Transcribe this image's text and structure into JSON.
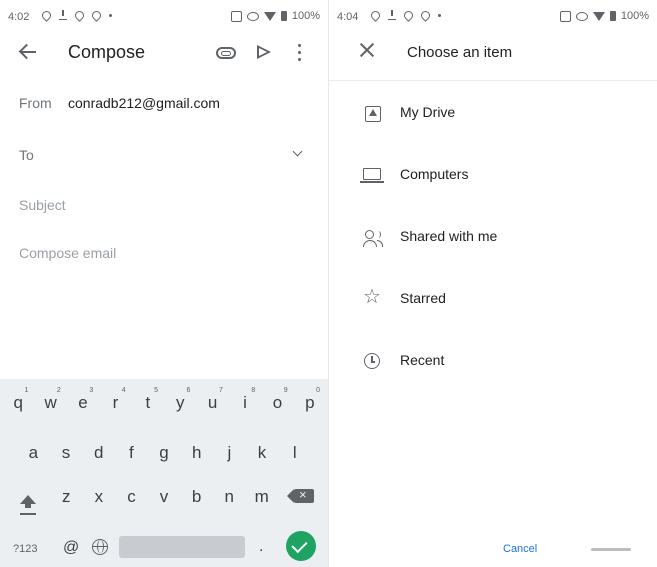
{
  "left_screen": {
    "status": {
      "time": "4:02",
      "battery": "100%"
    },
    "app_bar": {
      "title": "Compose"
    },
    "from": {
      "label": "From",
      "value": "conradb212@gmail.com"
    },
    "to": {
      "label": "To"
    },
    "subject": {
      "placeholder": "Subject"
    },
    "body": {
      "placeholder": "Compose email"
    },
    "keyboard": {
      "row1": [
        {
          "key": "q",
          "hint": "1"
        },
        {
          "key": "w",
          "hint": "2"
        },
        {
          "key": "e",
          "hint": "3"
        },
        {
          "key": "r",
          "hint": "4"
        },
        {
          "key": "t",
          "hint": "5"
        },
        {
          "key": "y",
          "hint": "6"
        },
        {
          "key": "u",
          "hint": "7"
        },
        {
          "key": "i",
          "hint": "8"
        },
        {
          "key": "o",
          "hint": "9"
        },
        {
          "key": "p",
          "hint": "0"
        }
      ],
      "row2": [
        "a",
        "s",
        "d",
        "f",
        "g",
        "h",
        "j",
        "k",
        "l"
      ],
      "row3": [
        "z",
        "x",
        "c",
        "v",
        "b",
        "n",
        "m"
      ],
      "symbols_label": "?123",
      "at_label": "@",
      "period_label": "."
    }
  },
  "right_screen": {
    "status": {
      "time": "4:04",
      "battery": "100%"
    },
    "header": {
      "title": "Choose an item"
    },
    "items": [
      {
        "label": "My Drive",
        "icon": "drive-icon"
      },
      {
        "label": "Computers",
        "icon": "computer-icon"
      },
      {
        "label": "Shared with me",
        "icon": "shared-people-icon"
      },
      {
        "label": "Starred",
        "icon": "star-icon"
      },
      {
        "label": "Recent",
        "icon": "clock-icon"
      }
    ],
    "cancel_label": "Cancel"
  }
}
